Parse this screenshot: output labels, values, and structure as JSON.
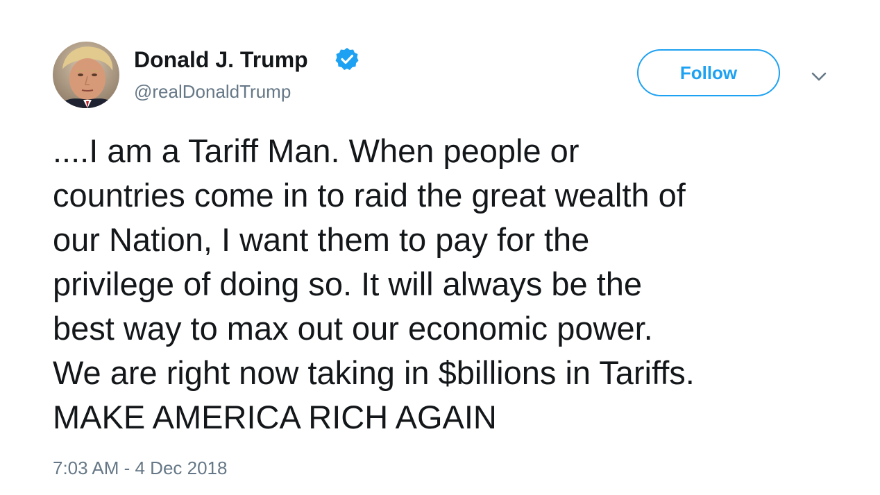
{
  "tweet": {
    "author": {
      "display_name": "Donald J. Trump",
      "handle": "@realDonaldTrump",
      "verified": true,
      "avatar_icon": "profile-photo"
    },
    "follow_label": "Follow",
    "menu_icon": "chevron-down-icon",
    "text": "....I am a Tariff Man. When people or\ncountries come in to raid the great wealth of\nour Nation, I want them to pay for the\nprivilege of doing so. It will always be the\nbest way to max out our economic power.\nWe are right now taking in $billions in Tariffs.\nMAKE AMERICA RICH AGAIN",
    "timestamp": "7:03 AM - 4 Dec 2018"
  },
  "colors": {
    "accent": "#1da1f2",
    "text": "#14171a",
    "secondary_text": "#657786",
    "background": "#ffffff"
  }
}
